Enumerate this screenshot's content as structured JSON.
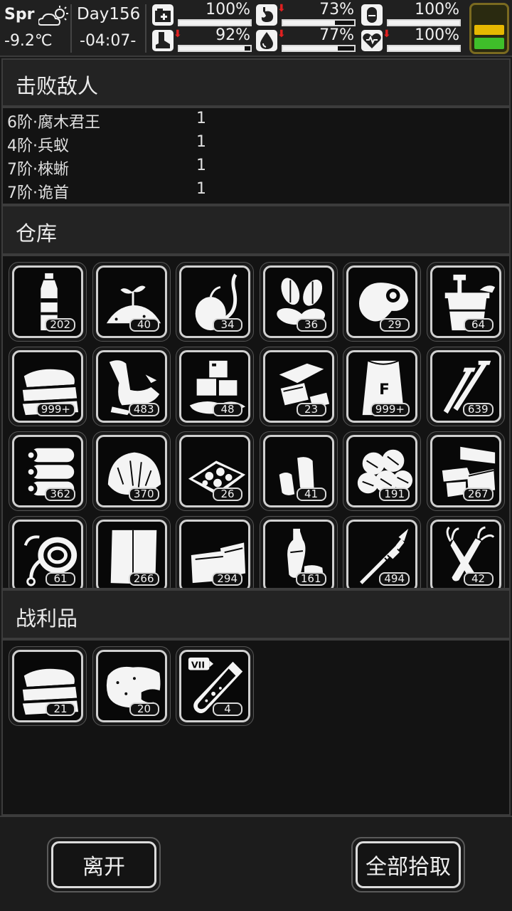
{
  "status_bar": {
    "season": "Spr",
    "weather_icon": "partly-sunny-icon",
    "temperature": "-9.2℃",
    "day": "Day156",
    "clock": "-04:07-",
    "stats": [
      {
        "name": "health",
        "icon": "medkit-icon",
        "arrow": "",
        "percent": "100%",
        "level": 1.0
      },
      {
        "name": "hunger",
        "icon": "stomach-icon",
        "arrow": "⬇",
        "percent": "73%",
        "level": 0.73
      },
      {
        "name": "mood",
        "icon": "pill-icon",
        "arrow": "",
        "percent": "100%",
        "level": 1.0
      },
      {
        "name": "stamina",
        "icon": "boot-icon",
        "arrow": "⬇",
        "percent": "92%",
        "level": 0.92
      },
      {
        "name": "thirst",
        "icon": "water-drop-icon",
        "arrow": "⬇",
        "percent": "77%",
        "level": 0.77
      },
      {
        "name": "heart",
        "icon": "heart-icon",
        "arrow": "⬇",
        "percent": "100%",
        "level": 1.0
      }
    ],
    "battery": {
      "top_color": "#e6b800",
      "bottom_color": "#3fbf2a"
    }
  },
  "defeated": {
    "title": "击败敌人",
    "enemies": [
      {
        "name": "6阶·腐木君王",
        "count": "1"
      },
      {
        "name": "4阶·兵蚁",
        "count": "1"
      },
      {
        "name": "7阶·棶蜥",
        "count": "1"
      },
      {
        "name": "7阶·诡首",
        "count": "1"
      }
    ]
  },
  "warehouse": {
    "title": "仓库",
    "items": [
      {
        "icon": "water-bottle-icon",
        "count": "202"
      },
      {
        "icon": "seedling-soil-icon",
        "count": "40"
      },
      {
        "icon": "sprouting-seed-icon",
        "count": "34"
      },
      {
        "icon": "nuts-icon",
        "count": "36"
      },
      {
        "icon": "egg-meat-icon",
        "count": "29"
      },
      {
        "icon": "bucket-icon",
        "count": "64"
      },
      {
        "icon": "cloth-stack-icon",
        "count": "999+"
      },
      {
        "icon": "leather-scraps-icon",
        "count": "483"
      },
      {
        "icon": "ice-cubes-icon",
        "count": "48"
      },
      {
        "icon": "metal-sheets-icon",
        "count": "23"
      },
      {
        "icon": "fertilizer-bag-icon",
        "count": "999+"
      },
      {
        "icon": "nails-icon",
        "count": "639"
      },
      {
        "icon": "logs-icon",
        "count": "362"
      },
      {
        "icon": "fiber-pile-icon",
        "count": "370"
      },
      {
        "icon": "ore-tray-icon",
        "count": "26"
      },
      {
        "icon": "rubber-pieces-icon",
        "count": "41"
      },
      {
        "icon": "coal-lumps-icon",
        "count": "191"
      },
      {
        "icon": "bricks-icon",
        "count": "267"
      },
      {
        "icon": "rope-icon",
        "count": "61"
      },
      {
        "icon": "paper-sheet-icon",
        "count": "266"
      },
      {
        "icon": "fabric-folded-icon",
        "count": "294"
      },
      {
        "icon": "plastic-bottles-icon",
        "count": "161"
      },
      {
        "icon": "spear-icon",
        "count": "494"
      },
      {
        "icon": "carrots-icon",
        "count": "42"
      }
    ]
  },
  "loot": {
    "title": "战利品",
    "items": [
      {
        "icon": "cloth-stack-icon",
        "count": "21"
      },
      {
        "icon": "hide-pelt-icon",
        "count": "20"
      },
      {
        "icon": "test-tube-icon",
        "count": "4",
        "tag": "VII"
      }
    ]
  },
  "buttons": {
    "leave": "离开",
    "take_all": "全部拾取"
  }
}
